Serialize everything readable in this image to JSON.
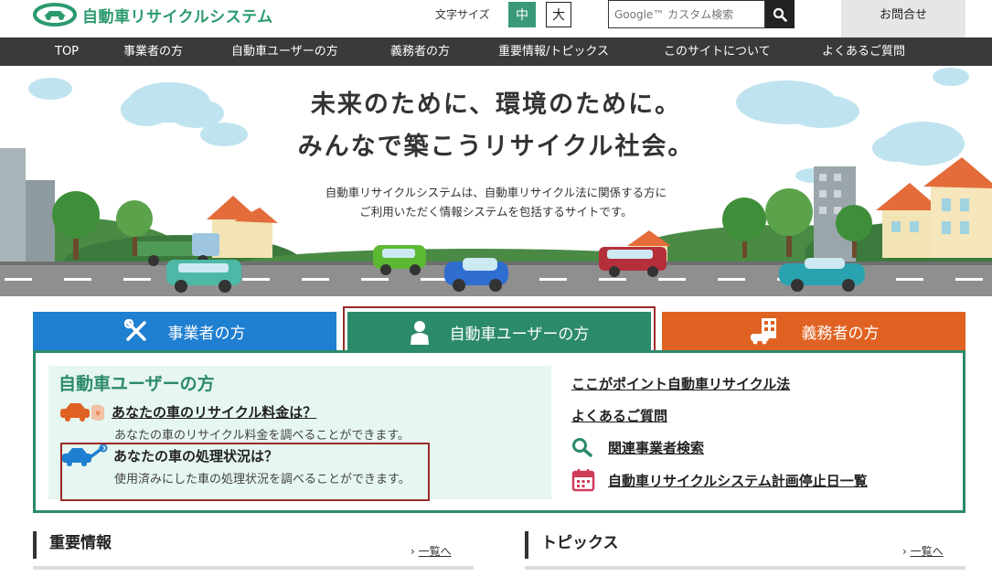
{
  "header": {
    "logo_text": "自動車リサイクルシステム",
    "font_size_label": "文字サイズ",
    "font_size_medium": "中",
    "font_size_large": "大",
    "search_placeholder": "Google™ カスタム検索",
    "contact_label": "お問合せ"
  },
  "nav": {
    "items": [
      "TOP",
      "事業者の方",
      "自動車ユーザーの方",
      "義務者の方",
      "重要情報/トピックス",
      "このサイトについて",
      "よくあるご質問"
    ]
  },
  "hero": {
    "title_line1": "未来のために、環境のために。",
    "title_line2": "みんなで築こうリサイクル社会。",
    "subtitle_line1": "自動車リサイクルシステムは、自動車リサイクル法に関係する方に",
    "subtitle_line2": "ご利用いただく情報システムを包括するサイトです。"
  },
  "tabs": {
    "business": "事業者の方",
    "user": "自動車ユーザーの方",
    "obligor": "義務者の方"
  },
  "panel": {
    "heading": "自動車ユーザーの方",
    "fee_title": "あなたの車のリサイクル料金は？",
    "fee_desc": "あなたの車のリサイクル料金を調べることができます。",
    "status_title": "あなたの車の処理状況は？",
    "status_desc": "使用済みにした車の処理状況を調べることができます。",
    "right_links": [
      "ここがポイント自動車リサイクル法",
      "よくあるご質問",
      "関連事業者検索",
      "自動車リサイクルシステム計画停止日一覧"
    ]
  },
  "sections": {
    "important_title": "重要情報",
    "topics_title": "トピックス",
    "more_label": "一覧へ",
    "more_arrow": "›"
  },
  "colors": {
    "brand_green": "#2b8a6a",
    "business_blue": "#1f7fd0",
    "obligor_orange": "#e06222",
    "nav_dark": "#3a3a3a",
    "highlight_red": "#9b2a2a"
  }
}
